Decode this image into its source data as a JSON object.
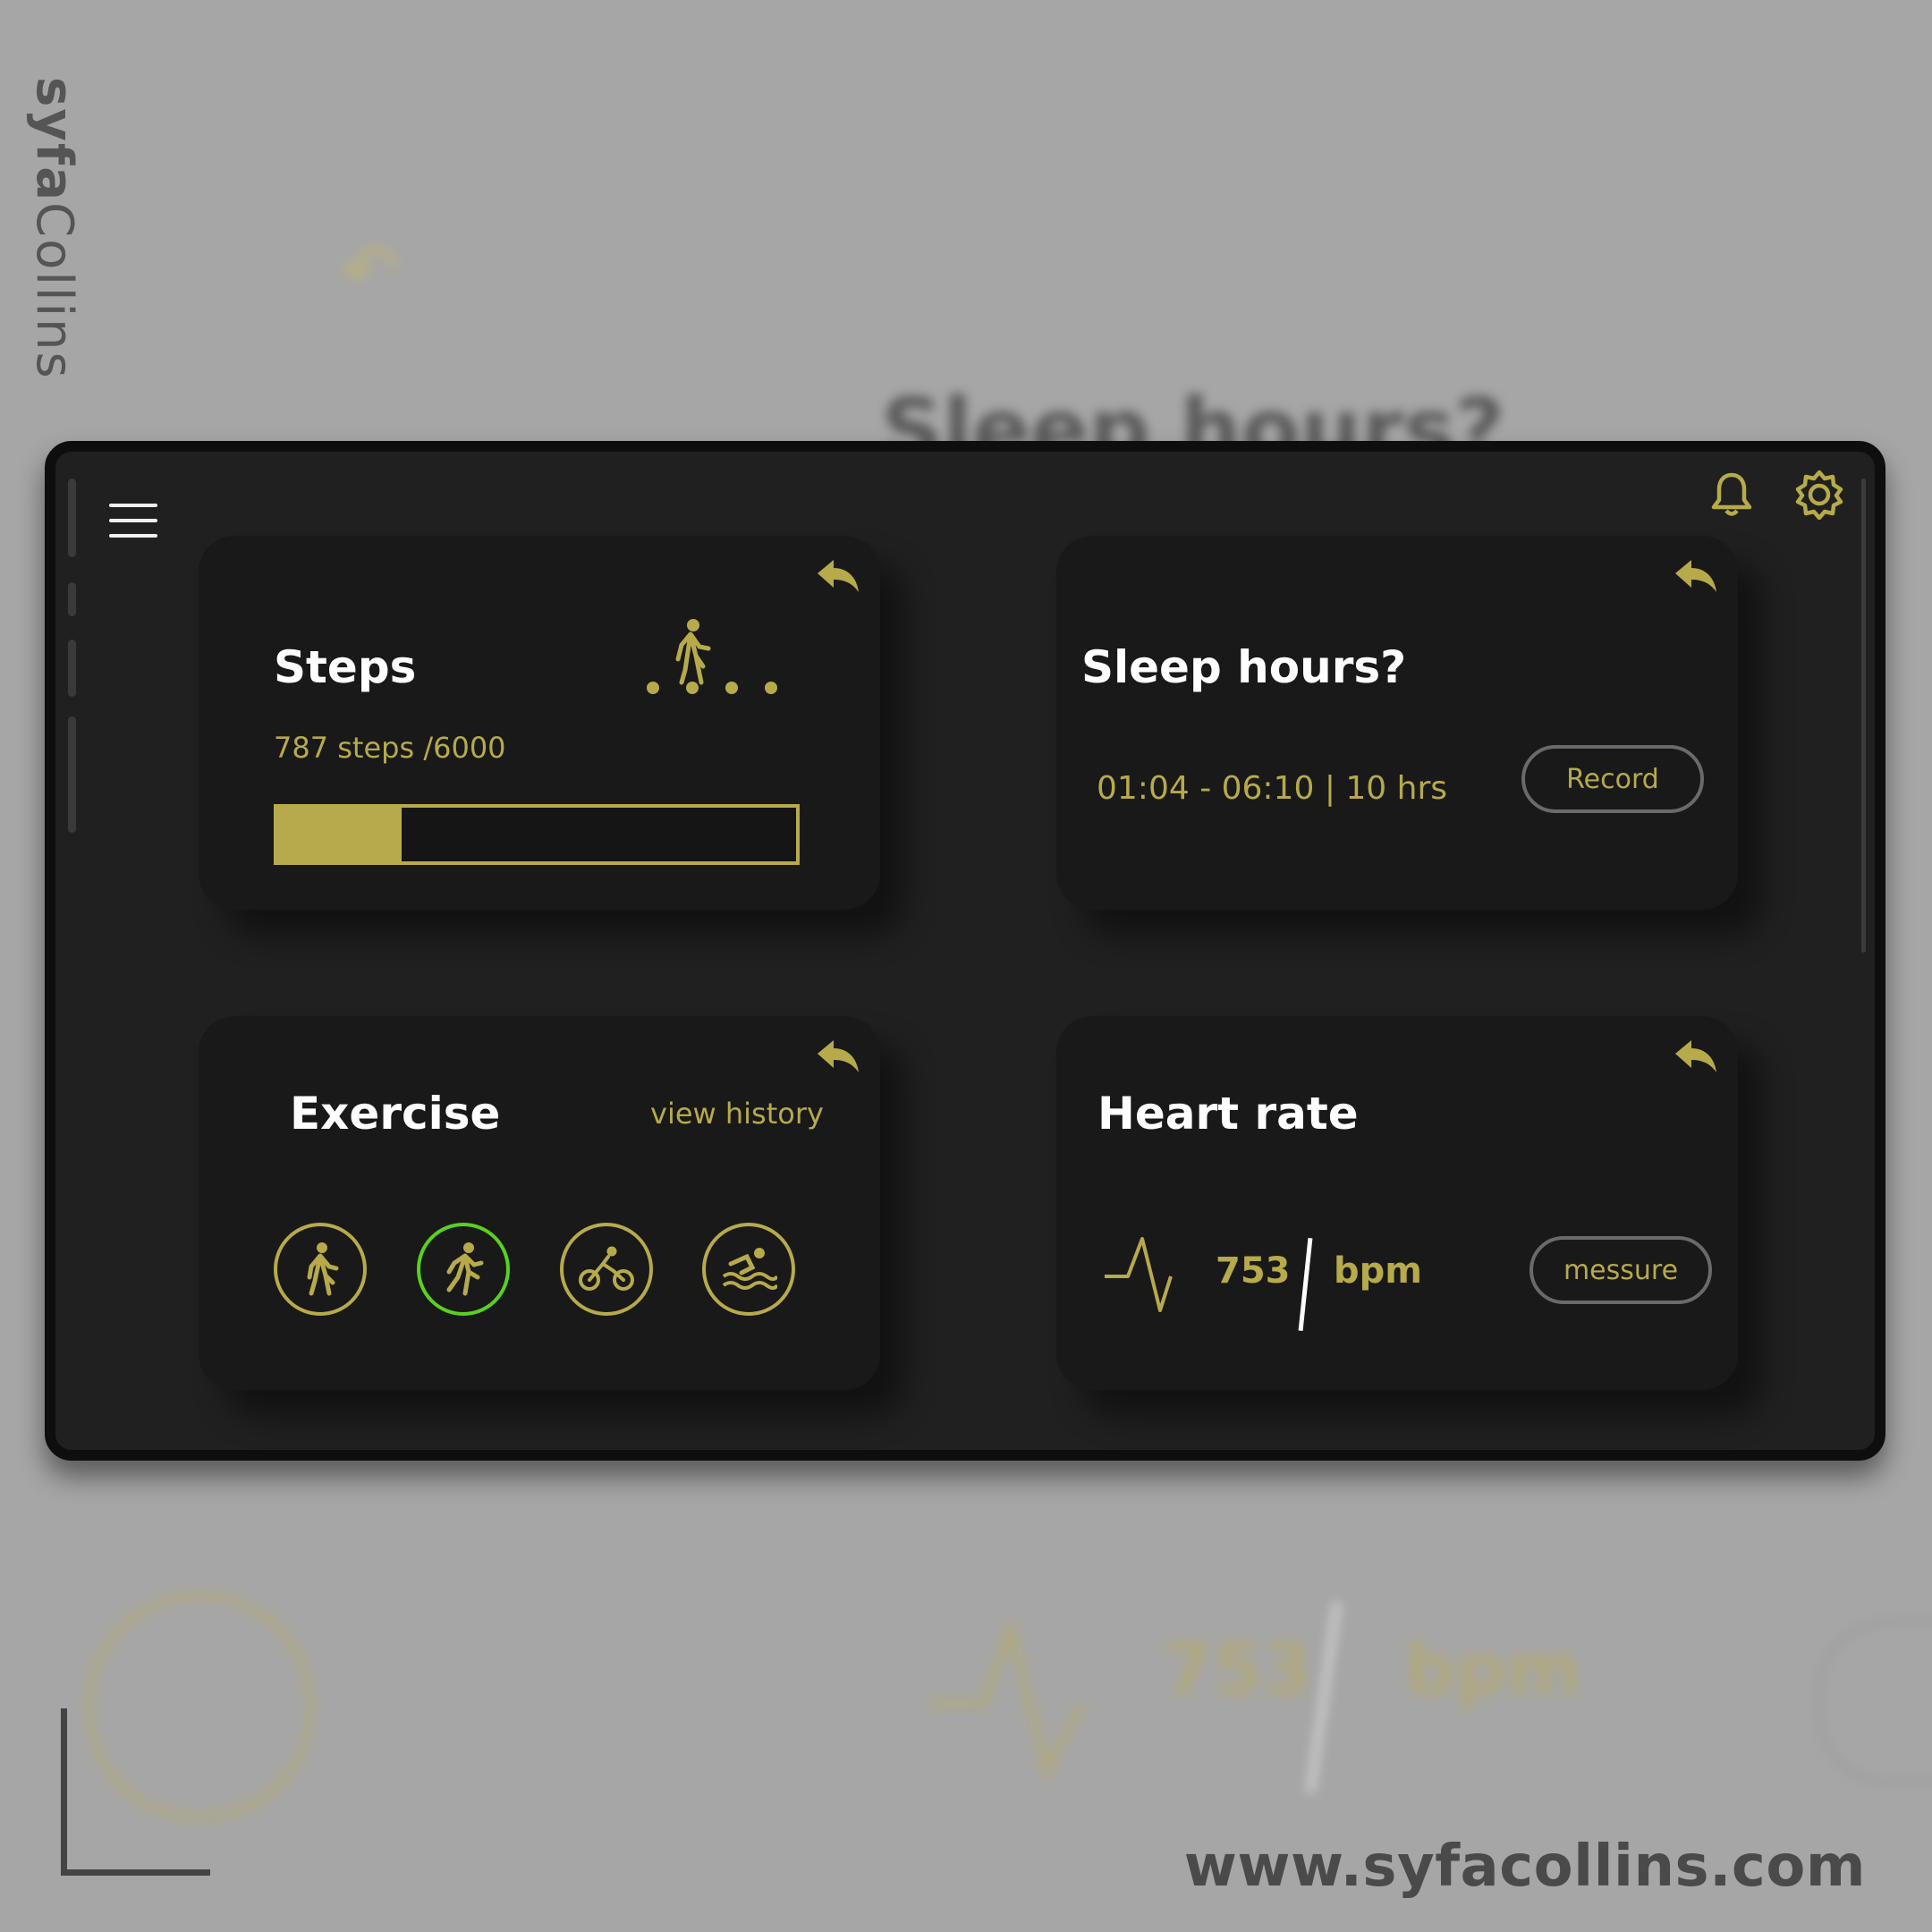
{
  "colors": {
    "accent": "#b7aa4a",
    "active": "#59d11e",
    "card": "#191919",
    "panel": "#202020"
  },
  "branding": {
    "vertical_bold": "syfa",
    "vertical_rest": "Collins",
    "website": "www.syfacollins.com"
  },
  "background": {
    "ghost_title": "Sleep hours?",
    "ghost_value": "753",
    "ghost_unit": "bpm"
  },
  "header": {
    "menu_icon": "hamburger-icon",
    "notification_icon": "bell-icon",
    "settings_icon": "gear-icon"
  },
  "steps": {
    "title": "Steps",
    "summary": "787 steps /6000",
    "progress_fraction": 0.24,
    "icon": "walking-dots-icon"
  },
  "sleep": {
    "title": "Sleep hours?",
    "range": "01:04 - 06:10 | 10 hrs",
    "button": "Record"
  },
  "exercise": {
    "title": "Exercise",
    "history_link": "view history",
    "activities": [
      "walk-icon",
      "run-icon",
      "bike-icon",
      "swim-icon"
    ],
    "selected_index": 1
  },
  "heart": {
    "title": "Heart rate",
    "value": "753",
    "unit": "bpm",
    "button": "messure"
  }
}
